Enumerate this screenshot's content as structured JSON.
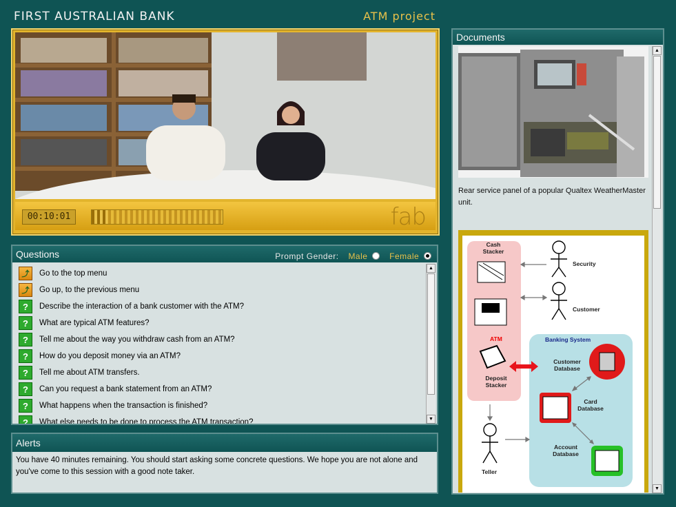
{
  "header": {
    "app_title": "FIRST AUSTRALIAN BANK",
    "project": "ATM project"
  },
  "video": {
    "time": "00:10:01",
    "progress": 0.12,
    "logo": "fab"
  },
  "questions": {
    "title": "Questions",
    "prompt_gender_label": "Prompt Gender:",
    "male_label": "Male",
    "female_label": "Female",
    "selected_gender": "Female",
    "items": [
      {
        "icon": "folder-up-icon",
        "text": "Go to the top menu"
      },
      {
        "icon": "folder-up-icon",
        "text": "Go up, to the previous menu"
      },
      {
        "icon": "question-icon",
        "text": "Describe the interaction of a bank customer with the ATM?"
      },
      {
        "icon": "question-icon",
        "text": "What are typical ATM features?"
      },
      {
        "icon": "question-icon",
        "text": "Tell me about the way you withdraw cash from an ATM?"
      },
      {
        "icon": "question-icon",
        "text": "How do you deposit money via an ATM?"
      },
      {
        "icon": "question-icon",
        "text": "Tell me about ATM transfers."
      },
      {
        "icon": "question-icon",
        "text": "Can you request a bank statement from an ATM?"
      },
      {
        "icon": "question-icon",
        "text": "What happens when the transaction is finished?"
      },
      {
        "icon": "question-icon",
        "text": "What else needs to be done to process the ATM transaction?"
      }
    ]
  },
  "alerts": {
    "title": "Alerts",
    "text": "You have 40 minutes remaining.  You should start asking some concrete questions. We hope you are not alone and you've come to this session with a good note taker."
  },
  "documents": {
    "title": "Documents",
    "caption": "Rear service panel of a popular Qualtex WeatherMaster unit.",
    "diagram": {
      "cash_stacker": "Cash Stacker",
      "atm": "ATM",
      "deposit_stacker": "Deposit Stacker",
      "security": "Security",
      "customer": "Customer",
      "teller": "Teller",
      "banking_system": "Banking System",
      "customer_database": "Customer Database",
      "card_database": "Card Database",
      "account_database": "Account Database"
    }
  }
}
